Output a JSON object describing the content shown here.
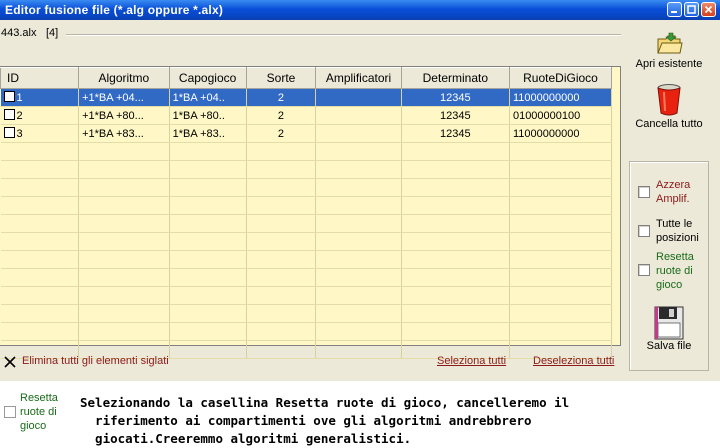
{
  "window": {
    "title": "Editor fusione file (*.alg oppure *.alx)",
    "title_color": "#0a4fd8",
    "background": "#ece9d8"
  },
  "file": {
    "name": "443.alx",
    "count": "[4]"
  },
  "grid": {
    "columns": [
      "ID",
      "Algoritmo",
      "Capogioco",
      "Sorte",
      "Amplificatori",
      "Determinato",
      "RuoteDiGioco"
    ],
    "rows": [
      {
        "id": "1",
        "algoritmo": "+1*BA +04...",
        "capogioco": "1*BA +04..",
        "sorte": "2",
        "amplificatori": "",
        "determinato": "12345",
        "ruote": "11000000000",
        "selected": true
      },
      {
        "id": "2",
        "algoritmo": "+1*BA +80...",
        "capogioco": "1*BA +80..",
        "sorte": "2",
        "amplificatori": "",
        "determinato": "12345",
        "ruote": "01000000100",
        "selected": false
      },
      {
        "id": "3",
        "algoritmo": "+1*BA +83...",
        "capogioco": "1*BA +83..",
        "sorte": "2",
        "amplificatori": "",
        "determinato": "12345",
        "ruote": "11000000000",
        "selected": false
      }
    ],
    "background": "#fff8c6",
    "selection_color": "#316ac5"
  },
  "actions": {
    "eliminate": "Elimina tutti gli elementi siglati",
    "select_all": "Seleziona tutti",
    "deselect_all": "Deseleziona tutti"
  },
  "sidebar": {
    "open_existing": "Apri esistente",
    "clear_all": "Cancella tutto",
    "save_file": "Salva file",
    "options": [
      {
        "line1": "Azzera",
        "line2": "Amplif.",
        "line3": "",
        "color": "#8b1a1a"
      },
      {
        "line1": "Tutte le",
        "line2": "posizioni",
        "line3": "",
        "color": "#000000"
      },
      {
        "line1": "Resetta",
        "line2": "ruote di",
        "line3": "gioco",
        "color": "#1a6b1a"
      }
    ]
  },
  "bottom": {
    "option_line1": "Resetta",
    "option_line2": "ruote di",
    "option_line3": "gioco",
    "caption_line1": "Selezionando la casellina Resetta ruote di gioco, cancelleremo il",
    "caption_line2": "riferimento ai compartimenti ove gli algoritmi andrebbrero",
    "caption_line3": "giocati.Creeremmo algoritmi generalistici."
  }
}
